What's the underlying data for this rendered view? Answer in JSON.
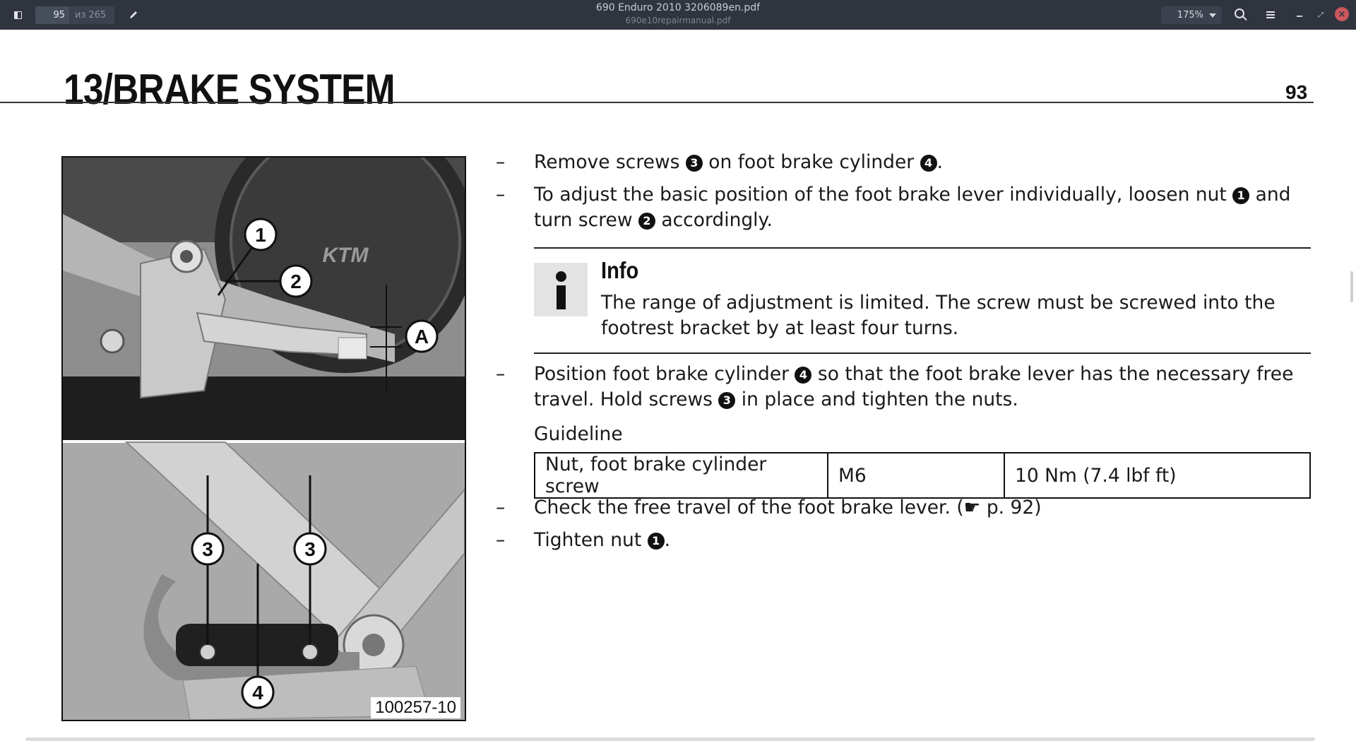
{
  "toolbar": {
    "current_page": "95",
    "page_total": "из 265",
    "doc_title": "690 Enduro 2010 3206089en.pdf",
    "doc_subtitle": "690e10repairmanual.pdf",
    "zoom": "175%",
    "icons": {
      "sidebar": "sidebar-toggle-icon",
      "annotate": "pencil-icon",
      "search": "search-icon",
      "menu": "hamburger-menu-icon",
      "minimize": "minimize-icon",
      "maximize": "maximize-icon",
      "close": "close-icon"
    },
    "close_color": "#cc575d",
    "bar_color": "#2f343f"
  },
  "document": {
    "chapter_title": "13/BRAKE SYSTEM",
    "page_number": "93",
    "figure": {
      "code": "100257-10",
      "callouts": [
        "1",
        "2",
        "A",
        "3",
        "3",
        "4"
      ],
      "logo_text": "KTM"
    },
    "steps": [
      {
        "dash": "–",
        "before": "Remove screws ",
        "n1": "3",
        "middle": " on foot brake cylinder ",
        "n2": "4",
        "after": "."
      },
      {
        "dash": "–",
        "before": "To adjust the basic position of the foot brake lever individually, loosen nut ",
        "n1": "1",
        "middle": " and turn screw ",
        "n2": "2",
        "after": " accordingly."
      },
      {
        "dash": "–",
        "before": "Position foot brake cylinder ",
        "n1": "4",
        "middle": " so that the foot brake lever has the necessary free travel. Hold screws ",
        "n2": "3",
        "after": " in place and tighten the nuts."
      },
      {
        "dash": "–",
        "before": "Check the free travel of the foot brake lever. (",
        "ref_icon": "☛",
        "after": " p. 92)"
      },
      {
        "dash": "–",
        "before": "Tighten nut ",
        "n1": "1",
        "after": "."
      }
    ],
    "info": {
      "heading": "Info",
      "text": "The range of adjustment is limited. The screw must be screwed into the footrest bracket by at least four turns."
    },
    "guideline": {
      "label": "Guideline",
      "row": [
        "Nut, foot brake cylinder screw",
        "M6",
        "10 Nm (7.4 lbf ft)"
      ]
    }
  }
}
